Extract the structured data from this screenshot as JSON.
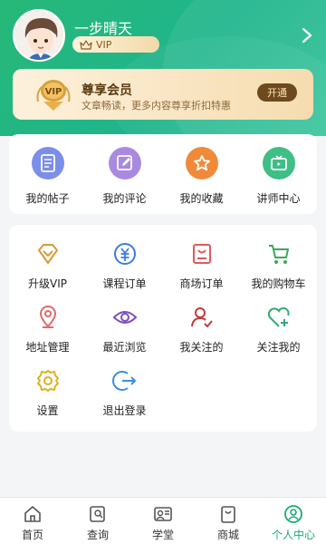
{
  "user": {
    "name": "一步晴天",
    "vip_label": "VIP"
  },
  "member": {
    "crest_text": "VIP",
    "title": "尊享会员",
    "subtitle": "文章畅读，更多内容尊享折扣特惠",
    "button": "开通"
  },
  "quick": [
    {
      "label": "我的帖子",
      "icon": "document-icon",
      "color": "#7b8ee8"
    },
    {
      "label": "我的评论",
      "icon": "edit-icon",
      "color": "#a98ae0"
    },
    {
      "label": "我的收藏",
      "icon": "star-icon",
      "color": "#f08a3a"
    },
    {
      "label": "讲师中心",
      "icon": "tv-icon",
      "color": "#3dbf86"
    }
  ],
  "services": [
    {
      "label": "升级VIP",
      "icon": "diamond-icon"
    },
    {
      "label": "课程订单",
      "icon": "course-order-icon"
    },
    {
      "label": "商场订单",
      "icon": "shop-order-icon"
    },
    {
      "label": "我的购物车",
      "icon": "cart-icon"
    },
    {
      "label": "地址管理",
      "icon": "location-icon"
    },
    {
      "label": "最近浏览",
      "icon": "eye-icon"
    },
    {
      "label": "我关注的",
      "icon": "user-check-icon"
    },
    {
      "label": "关注我的",
      "icon": "heart-plus-icon"
    },
    {
      "label": "设置",
      "icon": "settings-icon"
    },
    {
      "label": "退出登录",
      "icon": "logout-icon"
    }
  ],
  "tabs": [
    {
      "label": "首页",
      "icon": "home-icon"
    },
    {
      "label": "查询",
      "icon": "search-doc-icon"
    },
    {
      "label": "学堂",
      "icon": "school-icon"
    },
    {
      "label": "商城",
      "icon": "bag-icon"
    },
    {
      "label": "个人中心",
      "icon": "profile-icon",
      "active": true
    }
  ],
  "colors": {
    "brand_green": "#1aab74",
    "gold": "#c8902c"
  }
}
